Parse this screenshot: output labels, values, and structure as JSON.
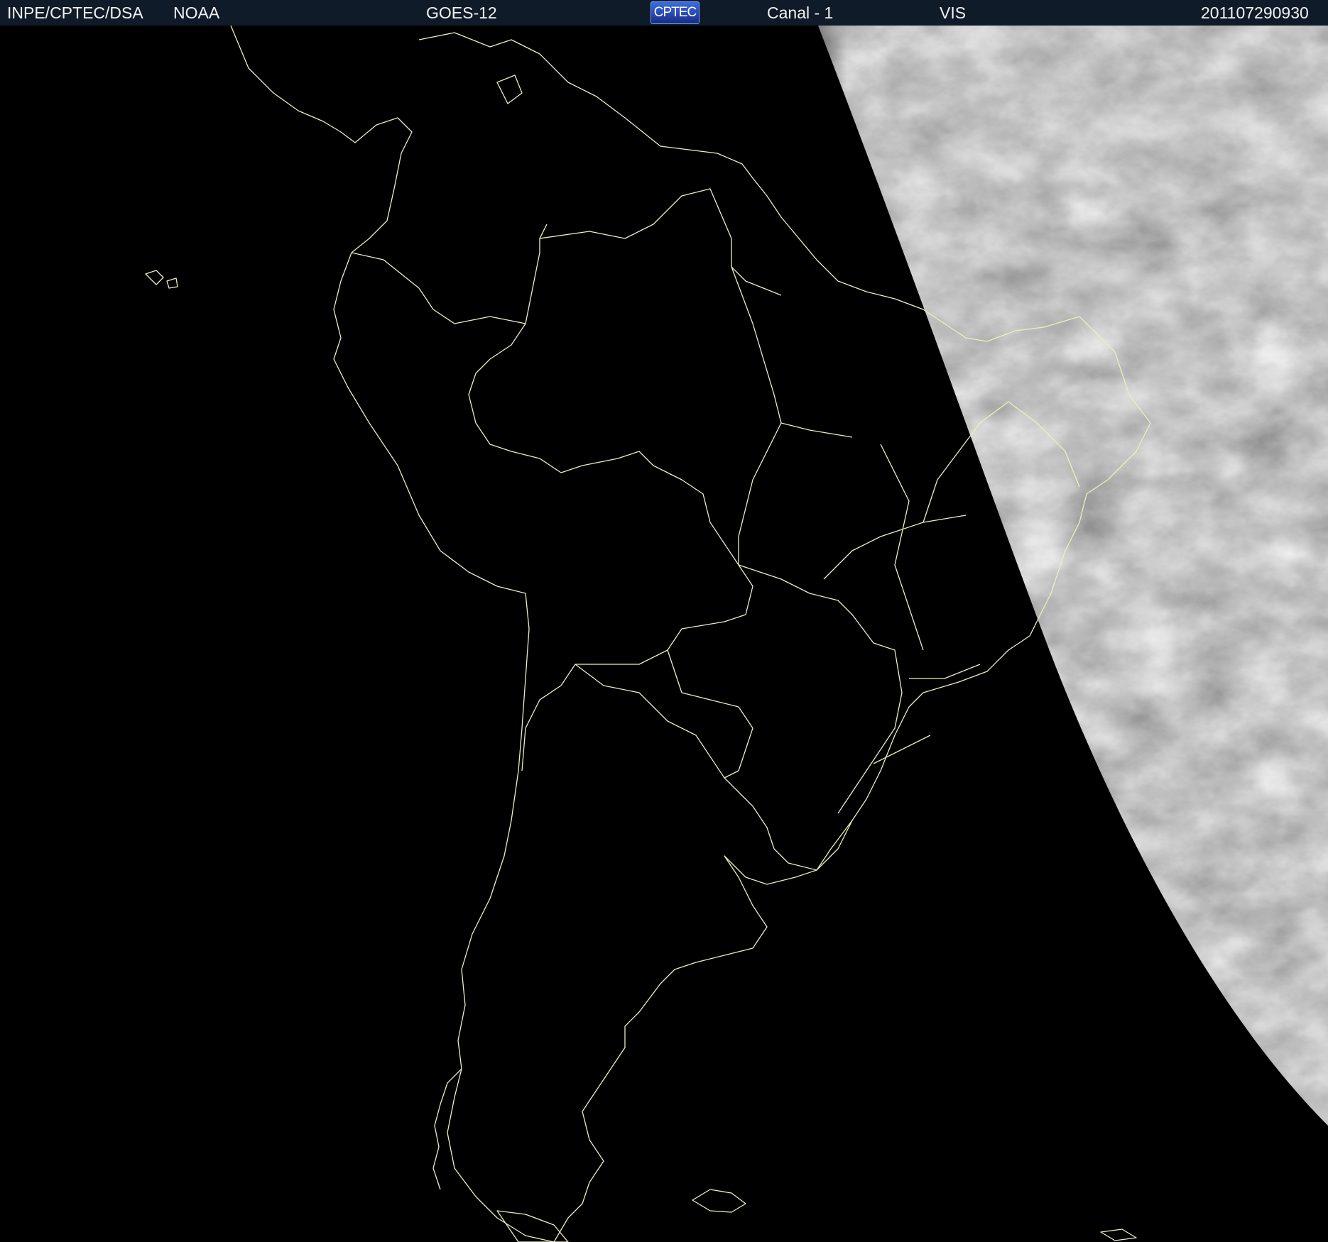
{
  "header": {
    "agency": "INPE/CPTEC/DSA",
    "operator": "NOAA",
    "satellite": "GOES-12",
    "logo_text": "CPTEC",
    "channel": "Canal - 1",
    "band": "VIS",
    "timestamp": "201107290930"
  },
  "colors": {
    "header_background": "#0f1b29",
    "header_text": "#f2f2f2",
    "space_background": "#000000",
    "boundary_lines": "#eeeebb",
    "cloud_light": "#e6e6e6",
    "cloud_dark": "#3a3a3a"
  },
  "map": {
    "region": "South America",
    "projection": "satellite view (GOES-12)",
    "lighting": "night side dark, day side visible on the right",
    "features": [
      "national borders",
      "state borders",
      "coastlines",
      "cloud cover"
    ]
  },
  "icons": {
    "logo": "cptec-logo"
  }
}
